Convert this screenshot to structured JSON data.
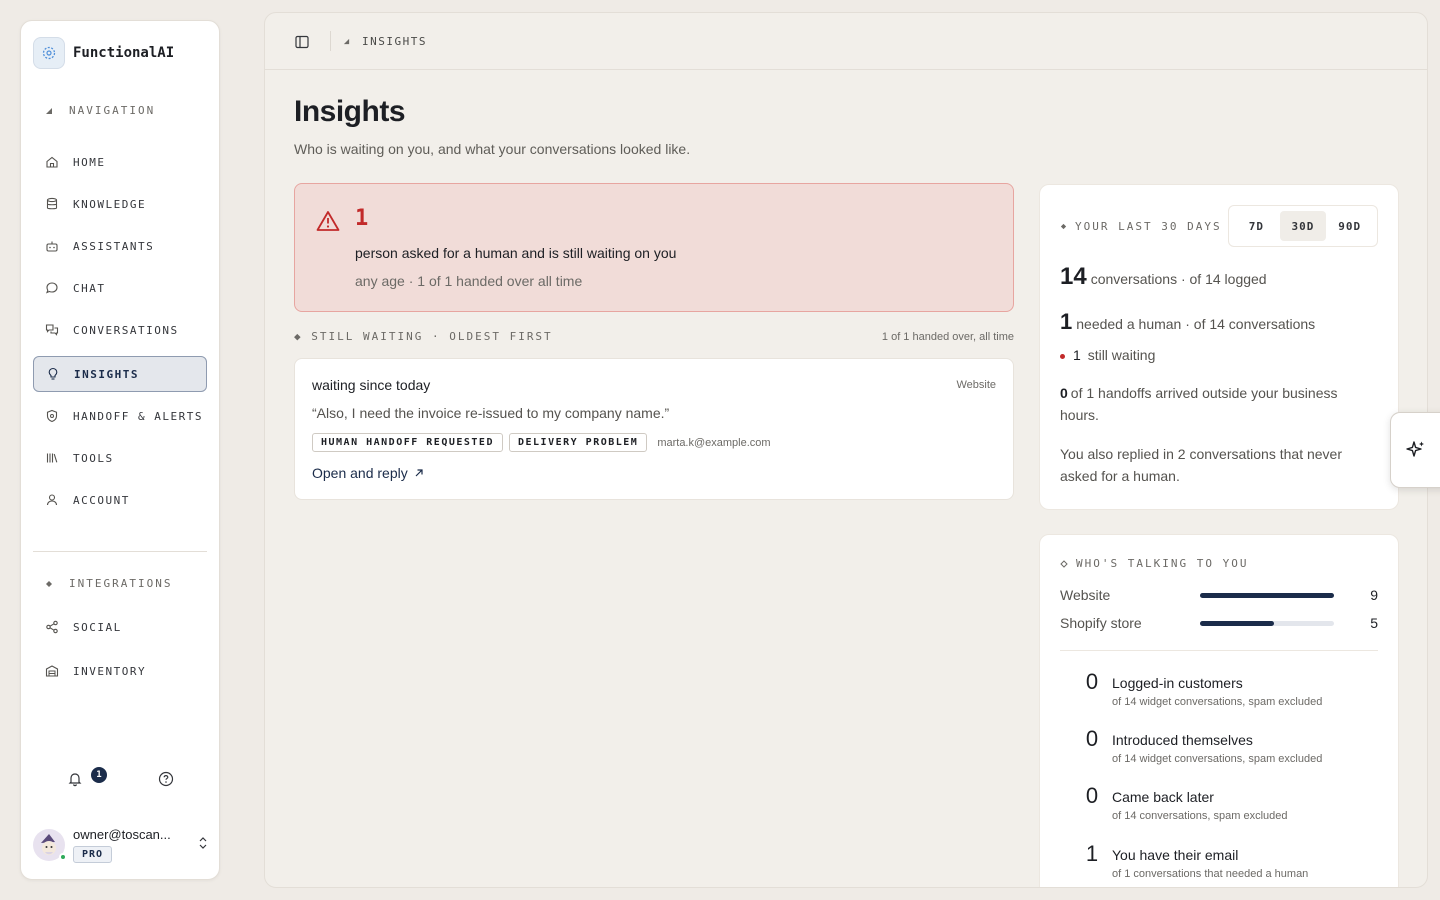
{
  "app": {
    "name": "FunctionalAI"
  },
  "sidebar": {
    "section_navigation": "NAVIGATION",
    "items": [
      {
        "label": "HOME",
        "icon": "home-icon"
      },
      {
        "label": "KNOWLEDGE",
        "icon": "database-icon"
      },
      {
        "label": "ASSISTANTS",
        "icon": "bot-icon"
      },
      {
        "label": "CHAT",
        "icon": "chat-bubble-icon"
      },
      {
        "label": "CONVERSATIONS",
        "icon": "conversations-icon"
      },
      {
        "label": "INSIGHTS",
        "icon": "lightbulb-icon",
        "active": true
      },
      {
        "label": "HANDOFF & ALERTS",
        "icon": "shield-icon"
      },
      {
        "label": "TOOLS",
        "icon": "library-icon"
      },
      {
        "label": "ACCOUNT",
        "icon": "user-icon"
      }
    ],
    "section_integrations": "INTEGRATIONS",
    "integration_items": [
      {
        "label": "SOCIAL",
        "icon": "share-icon"
      },
      {
        "label": "INVENTORY",
        "icon": "warehouse-icon"
      }
    ],
    "notifications_count": "1",
    "user": {
      "email": "owner@toscan...",
      "plan": "PRO"
    }
  },
  "topbar": {
    "breadcrumb": "INSIGHTS"
  },
  "page": {
    "title": "Insights",
    "subtitle": "Who is waiting on you, and what your conversations looked like."
  },
  "alert": {
    "count": "1",
    "title": "person asked for a human and is still waiting on you",
    "subtitle": "any age · 1 of 1 handed over all time"
  },
  "waiting": {
    "label": "STILL WAITING · OLDEST FIRST",
    "summary": "1 of 1 handed over, all time",
    "items": [
      {
        "title": "waiting since today",
        "source": "Website",
        "quote": "“Also, I need the invoice re-issued to my company name.”",
        "tags": [
          "HUMAN HANDOFF REQUESTED",
          "DELIVERY PROBLEM"
        ],
        "email": "marta.k@example.com",
        "link": "Open and reply"
      }
    ]
  },
  "stats": {
    "label": "YOUR LAST 30 DAYS",
    "ranges": [
      "7D",
      "30D",
      "90D"
    ],
    "selected_range": "30D",
    "conversations_num": "14",
    "conversations_text": "conversations · of 14 logged",
    "needed_human_num": "1",
    "needed_human_text": "needed a human · of 14 conversations",
    "still_waiting_num": "1",
    "still_waiting_text": "still waiting",
    "outside_hours_num": "0",
    "outside_hours_text": "of 1 handoffs arrived outside your business hours.",
    "replied_text": "You also replied in 2 conversations that never asked for a human."
  },
  "talking": {
    "label": "WHO'S TALKING TO YOU",
    "channels": [
      {
        "name": "Website",
        "value": 9,
        "fraction": 1.0
      },
      {
        "name": "Shopify store",
        "value": 5,
        "fraction": 0.55
      }
    ],
    "metrics": [
      {
        "num": "0",
        "label": "Logged-in customers",
        "sub": "of 14 widget conversations, spam excluded"
      },
      {
        "num": "0",
        "label": "Introduced themselves",
        "sub": "of 14 widget conversations, spam excluded"
      },
      {
        "num": "0",
        "label": "Came back later",
        "sub": "of 14 conversations, spam excluded"
      },
      {
        "num": "1",
        "label": "You have their email",
        "sub": "of 1 conversations that needed a human"
      }
    ]
  },
  "colors": {
    "accent": "#1b2c4a",
    "alert": "#c22a2a",
    "alert_bg": "#f1dcd8"
  }
}
